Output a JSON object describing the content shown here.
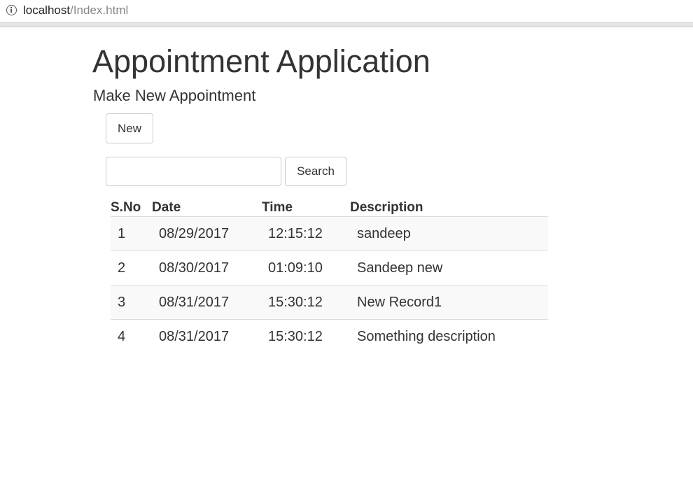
{
  "browser": {
    "url_host": "localhost",
    "url_path": "/Index.html"
  },
  "page": {
    "title": "Appointment Application",
    "subtitle": "Make New Appointment",
    "new_button": "New",
    "search_placeholder": "",
    "search_value": "",
    "search_button": "Search"
  },
  "table": {
    "headers": {
      "sno": "S.No",
      "date": "Date",
      "time": "Time",
      "description": "Description"
    },
    "rows": [
      {
        "sno": "1",
        "date": "08/29/2017",
        "time": "12:15:12",
        "description": "sandeep"
      },
      {
        "sno": "2",
        "date": "08/30/2017",
        "time": "01:09:10",
        "description": "Sandeep new"
      },
      {
        "sno": "3",
        "date": "08/31/2017",
        "time": "15:30:12",
        "description": "New Record1"
      },
      {
        "sno": "4",
        "date": "08/31/2017",
        "time": "15:30:12",
        "description": "Something description"
      }
    ]
  },
  "colors": {
    "text": "#333333",
    "border": "#cccccc",
    "row_stripe": "#f9f9f9",
    "row_divider": "#dddddd"
  }
}
